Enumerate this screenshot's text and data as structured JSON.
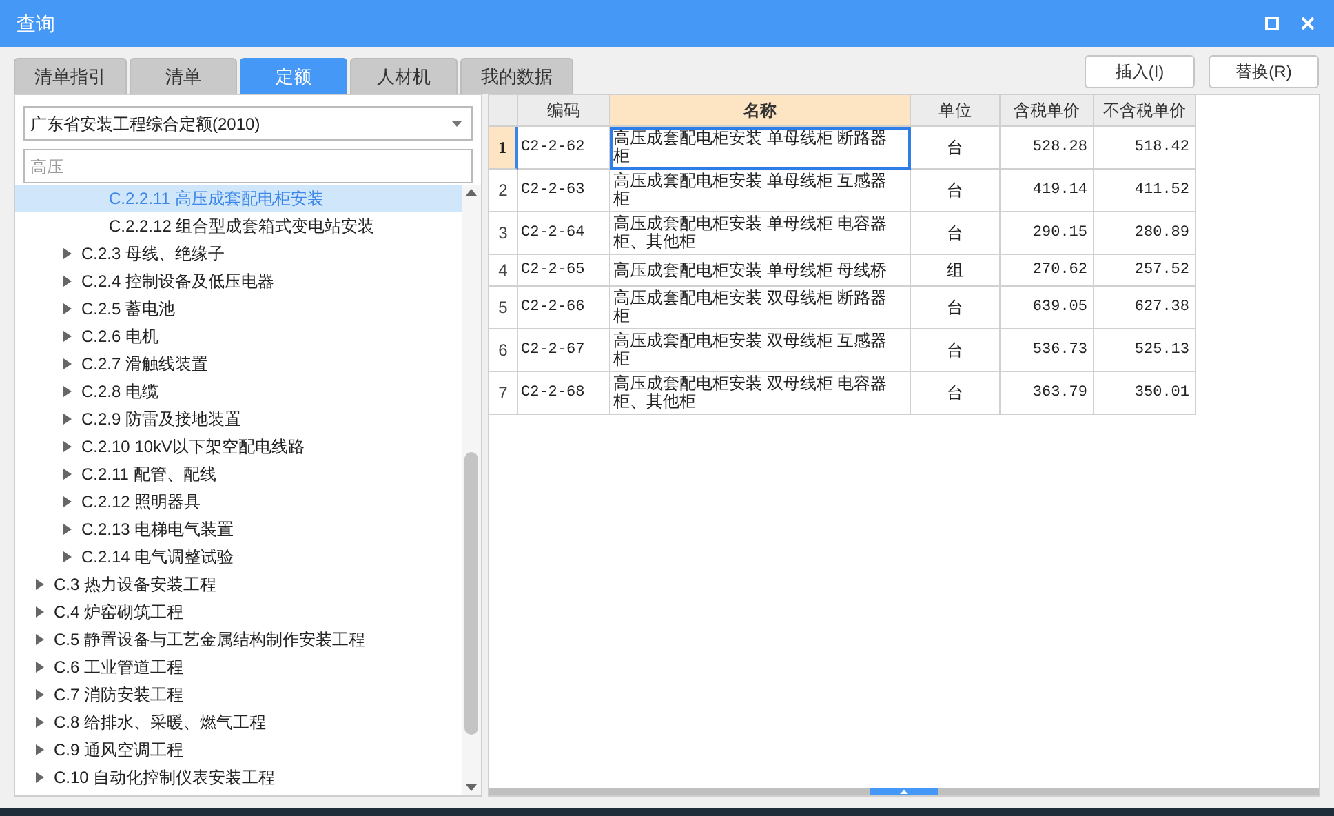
{
  "window": {
    "title": "查询"
  },
  "tabs": [
    {
      "label": "清单指引",
      "selected": false
    },
    {
      "label": "清单",
      "selected": false
    },
    {
      "label": "定额",
      "selected": true
    },
    {
      "label": "人材机",
      "selected": false
    },
    {
      "label": "我的数据",
      "selected": false
    }
  ],
  "buttons": [
    "插入(I)",
    "替换(R)"
  ],
  "library_select": {
    "value": "广东省安装工程综合定额(2010)"
  },
  "search": {
    "placeholder": "高压"
  },
  "tree": [
    {
      "children": [
        {
          "children": [
            {
              "label": "C.2.2.11 高压成套配电柜安装",
              "kind": "leaf",
              "selected": true
            },
            {
              "label": "C.2.2.12 组合型成套箱式变电站安装",
              "kind": "leaf",
              "selected": false
            }
          ]
        },
        {
          "label": "C.2.3 母线、绝缘子",
          "kind": "group",
          "expanded": false,
          "selected": false
        },
        {
          "label": "C.2.4 控制设备及低压电器",
          "kind": "group",
          "expanded": false,
          "selected": false
        },
        {
          "label": "C.2.5 蓄电池",
          "kind": "group",
          "expanded": false,
          "selected": false
        },
        {
          "label": "C.2.6 电机",
          "kind": "group",
          "expanded": false,
          "selected": false
        },
        {
          "label": "C.2.7 滑触线装置",
          "kind": "group",
          "expanded": false,
          "selected": false
        },
        {
          "label": "C.2.8 电缆",
          "kind": "group",
          "expanded": false,
          "selected": false
        },
        {
          "label": "C.2.9 防雷及接地装置",
          "kind": "group",
          "expanded": false,
          "selected": false
        },
        {
          "label": "C.2.10 10kV以下架空配电线路",
          "kind": "group",
          "expanded": false,
          "selected": false
        },
        {
          "label": "C.2.11 配管、配线",
          "kind": "group",
          "expanded": false,
          "selected": false
        },
        {
          "label": "C.2.12 照明器具",
          "kind": "group",
          "expanded": false,
          "selected": false
        },
        {
          "label": "C.2.13 电梯电气装置",
          "kind": "group",
          "expanded": false,
          "selected": false
        },
        {
          "label": "C.2.14 电气调整试验",
          "kind": "group",
          "expanded": false,
          "selected": false
        }
      ]
    },
    {
      "label": "C.3 热力设备安装工程",
      "kind": "group",
      "expanded": false,
      "selected": false
    },
    {
      "label": "C.4 炉窑砌筑工程",
      "kind": "group",
      "expanded": false,
      "selected": false
    },
    {
      "label": "C.5 静置设备与工艺金属结构制作安装工程",
      "kind": "group",
      "expanded": false,
      "selected": false
    },
    {
      "label": "C.6 工业管道工程",
      "kind": "group",
      "expanded": false,
      "selected": false
    },
    {
      "label": "C.7 消防安装工程",
      "kind": "group",
      "expanded": false,
      "selected": false
    },
    {
      "label": "C.8 给排水、采暖、燃气工程",
      "kind": "group",
      "expanded": false,
      "selected": false
    },
    {
      "label": "C.9 通风空调工程",
      "kind": "group",
      "expanded": false,
      "selected": false
    },
    {
      "label": "C.10 自动化控制仪表安装工程",
      "kind": "group",
      "expanded": false,
      "selected": false
    }
  ],
  "table": {
    "columns": [
      {
        "label": "编码",
        "selected": false
      },
      {
        "label": "名称",
        "selected": true
      },
      {
        "label": "单位",
        "selected": false
      },
      {
        "label": "含税单价",
        "selected": false
      },
      {
        "label": "不含税单价",
        "selected": false
      }
    ],
    "rows": [
      {
        "index": "1",
        "selected": true,
        "cells": [
          "C2-2-62",
          "高压成套配电柜安装 单母线柜 断路器柜",
          "台",
          "528.28",
          "518.42"
        ]
      },
      {
        "index": "2",
        "selected": false,
        "cells": [
          "C2-2-63",
          "高压成套配电柜安装 单母线柜 互感器柜",
          "台",
          "419.14",
          "411.52"
        ]
      },
      {
        "index": "3",
        "selected": false,
        "cells": [
          "C2-2-64",
          "高压成套配电柜安装 单母线柜 电容器柜、其他柜",
          "台",
          "290.15",
          "280.89"
        ]
      },
      {
        "index": "4",
        "selected": false,
        "cells": [
          "C2-2-65",
          "高压成套配电柜安装 单母线柜 母线桥",
          "组",
          "270.62",
          "257.52"
        ]
      },
      {
        "index": "5",
        "selected": false,
        "cells": [
          "C2-2-66",
          "高压成套配电柜安装 双母线柜 断路器柜",
          "台",
          "639.05",
          "627.38"
        ]
      },
      {
        "index": "6",
        "selected": false,
        "cells": [
          "C2-2-67",
          "高压成套配电柜安装 双母线柜 互感器柜",
          "台",
          "536.73",
          "525.13"
        ]
      },
      {
        "index": "7",
        "selected": false,
        "cells": [
          "C2-2-68",
          "高压成套配电柜安装 双母线柜 电容器柜、其他柜",
          "台",
          "363.79",
          "350.01"
        ]
      }
    ]
  }
}
